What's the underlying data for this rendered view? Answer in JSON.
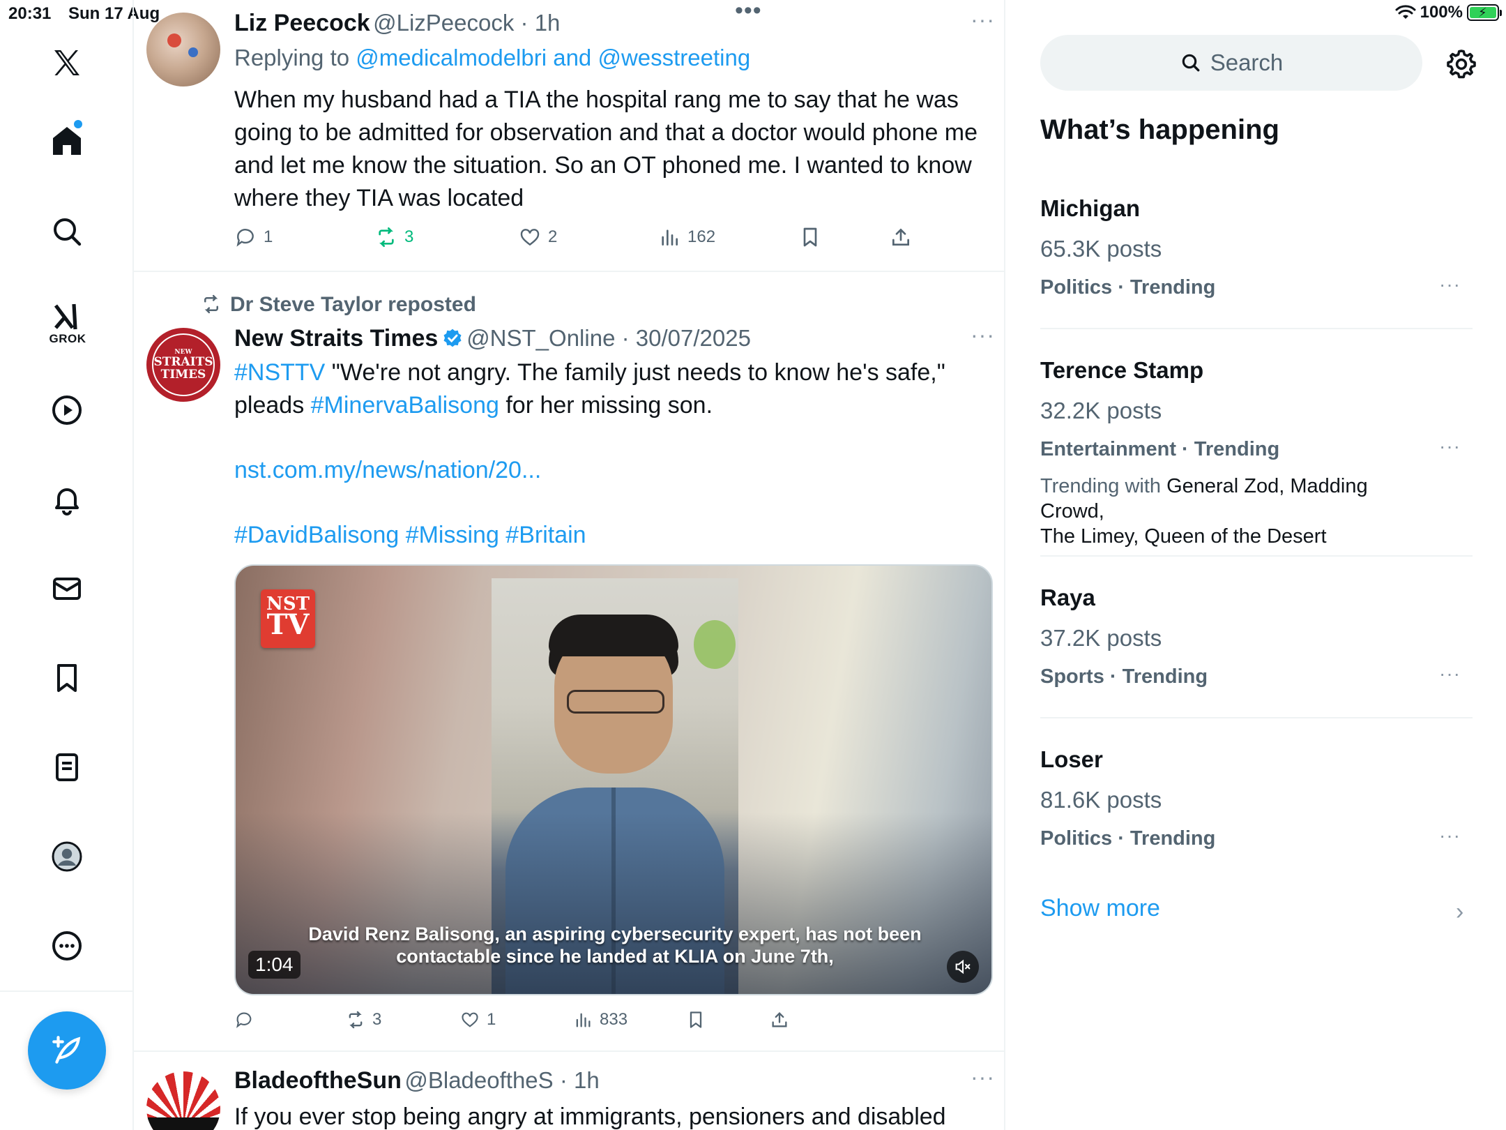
{
  "status_bar": {
    "time": "20:31",
    "date": "Sun 17 Aug",
    "battery": "100%"
  },
  "nav": {
    "items": [
      "X",
      "Home",
      "Explore",
      "Grok",
      "Video",
      "Notifications",
      "Messages",
      "Bookmarks",
      "Lists",
      "Profile",
      "More"
    ],
    "grok_label": "GROK"
  },
  "tweets": [
    {
      "name": "Liz Peecock",
      "handle": "@LizPeecock",
      "time": "1h",
      "replying_to_prefix": "Replying to",
      "replying_to": "@medicalmodelbri and @wesstreeting",
      "body_lines": [
        "When my husband had a TIA the hospital rang me to say that he was",
        "going to be admitted for observation and that a doctor would phone me",
        "and let me know the situation.  So an OT phoned me.  I wanted to know",
        "where they TIA was located"
      ],
      "replies": "1",
      "reposts": "3",
      "likes": "2",
      "views": "162"
    },
    {
      "reposted_by": "Dr Steve Taylor reposted",
      "name": "New Straits Times",
      "handle": "@NST_Online",
      "time": "30/07/2025",
      "body_line1_tag": "#NSTTV",
      "body_line1_rest": " \"We're not angry. The family just needs to know he's safe,\"",
      "body_line2_pre": "pleads ",
      "body_line2_tag": "#MinervaBalisong",
      "body_line2_rest": " for her missing son.",
      "link": "nst.com.my/news/nation/20...",
      "hashtags": "#DavidBalisong #Missing #Britain",
      "video": {
        "badge_top": "NST",
        "badge_bottom": "TV",
        "caption_line1": "David Renz Balisong, an aspiring cybersecurity expert, has not been",
        "caption_line2": "contactable since he landed at KLIA on June 7th,",
        "duration": "1:04"
      },
      "replies": "",
      "reposts": "3",
      "likes": "1",
      "views": "833"
    },
    {
      "name": "BladeoftheSun",
      "handle": "@BladeoftheS",
      "time": "1h",
      "body_lines": [
        "If you ever stop being angry at immigrants, pensioners and disabled"
      ]
    }
  ],
  "sidebar": {
    "search_placeholder": "Search",
    "whats_happening": "What’s happening",
    "trends": [
      {
        "name": "Michigan",
        "posts": "65.3K posts",
        "category": "Politics · Trending"
      },
      {
        "name": "Terence Stamp",
        "posts": "32.2K posts",
        "category": "Entertainment · Trending",
        "trending_with_label": "Trending with",
        "trending_with": " General Zod, Madding Crowd,",
        "trending_with2": "The Limey, Queen of the Desert"
      },
      {
        "name": "Raya",
        "posts": "37.2K posts",
        "category": "Sports · Trending"
      },
      {
        "name": "Loser",
        "posts": "81.6K posts",
        "category": "Politics · Trending"
      }
    ],
    "show_more": "Show more"
  },
  "colors": {
    "accent": "#1d9bf0",
    "repost_green": "#00ba7c",
    "muted": "#536471"
  }
}
